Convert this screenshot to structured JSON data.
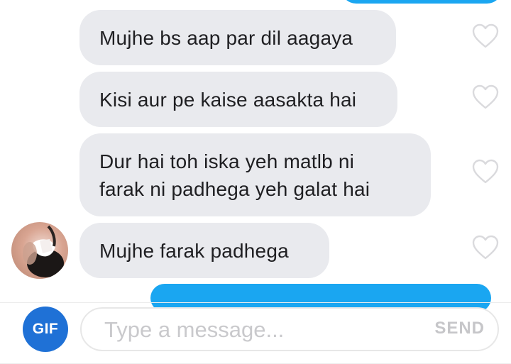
{
  "messages": [
    {
      "text": "Mujhe bs aap par dil aagaya"
    },
    {
      "text": "Kisi aur pe kaise aasakta hai"
    },
    {
      "text": "Dur hai toh iska yeh matlb ni farak ni padhega yeh galat hai"
    },
    {
      "text": "Mujhe farak padhega"
    }
  ],
  "composer": {
    "gif_label": "GIF",
    "placeholder": "Type a message...",
    "send_label": "SEND"
  },
  "colors": {
    "sent_bubble": "#1aa6f1",
    "received_bubble": "#e9eaee",
    "gif_button": "#1f71d6"
  },
  "icons": {
    "like": "heart-outline-icon"
  }
}
